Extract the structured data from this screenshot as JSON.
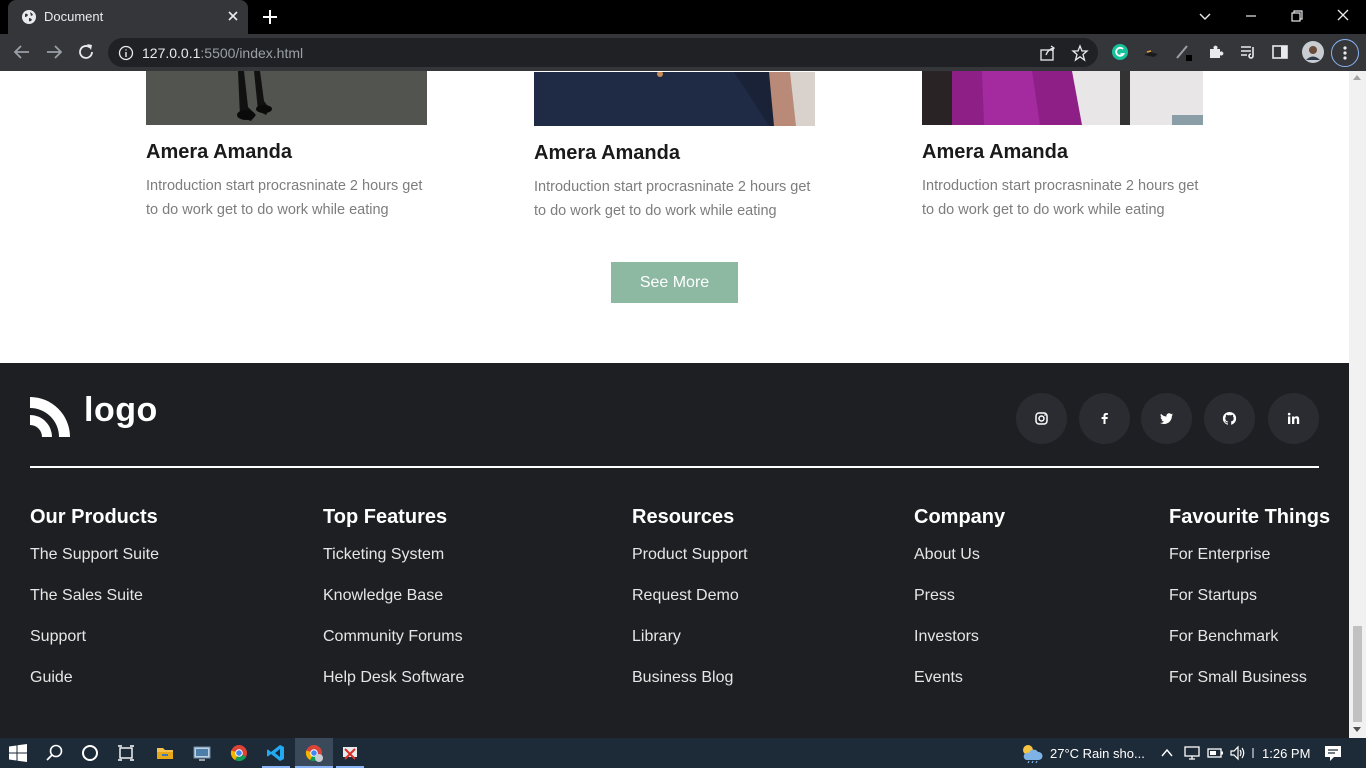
{
  "browser": {
    "tab_title": "Document",
    "url_host": "127.0.0.1",
    "url_path": ":5500/index.html"
  },
  "team": {
    "cards": [
      {
        "name": "Amera Amanda",
        "description": "Introduction start procrasninate 2 hours get to do work get to do work while eating"
      },
      {
        "name": "Amera Amanda",
        "description": "Introduction start procrasninate 2 hours get to do work get to do work while eating"
      },
      {
        "name": "Amera Amanda",
        "description": "Introduction start procrasninate 2 hours get to do work get to do work while eating"
      }
    ],
    "see_more_label": "See More",
    "accent_color": "#8db9a3"
  },
  "footer": {
    "logo_text": "logo",
    "social_icons": [
      "instagram-icon",
      "facebook-icon",
      "twitter-icon",
      "github-icon",
      "linkedin-icon"
    ],
    "columns": [
      {
        "title": "Our Products",
        "links": [
          "The Support Suite",
          "The Sales Suite",
          "Support",
          "Guide"
        ]
      },
      {
        "title": "Top Features",
        "links": [
          "Ticketing System",
          "Knowledge Base",
          "Community Forums",
          "Help Desk Software"
        ]
      },
      {
        "title": "Resources",
        "links": [
          "Product Support",
          "Request Demo",
          "Library",
          "Business Blog"
        ]
      },
      {
        "title": "Company",
        "links": [
          "About Us",
          "Press",
          "Investors",
          "Events"
        ]
      },
      {
        "title": "Favourite Things",
        "links": [
          "For Enterprise",
          "For Startups",
          "For Benchmark",
          "For Small Business"
        ]
      }
    ],
    "background_color": "#1e1f23"
  },
  "taskbar": {
    "weather": "27°C  Rain sho...",
    "time": "1:26 PM"
  }
}
